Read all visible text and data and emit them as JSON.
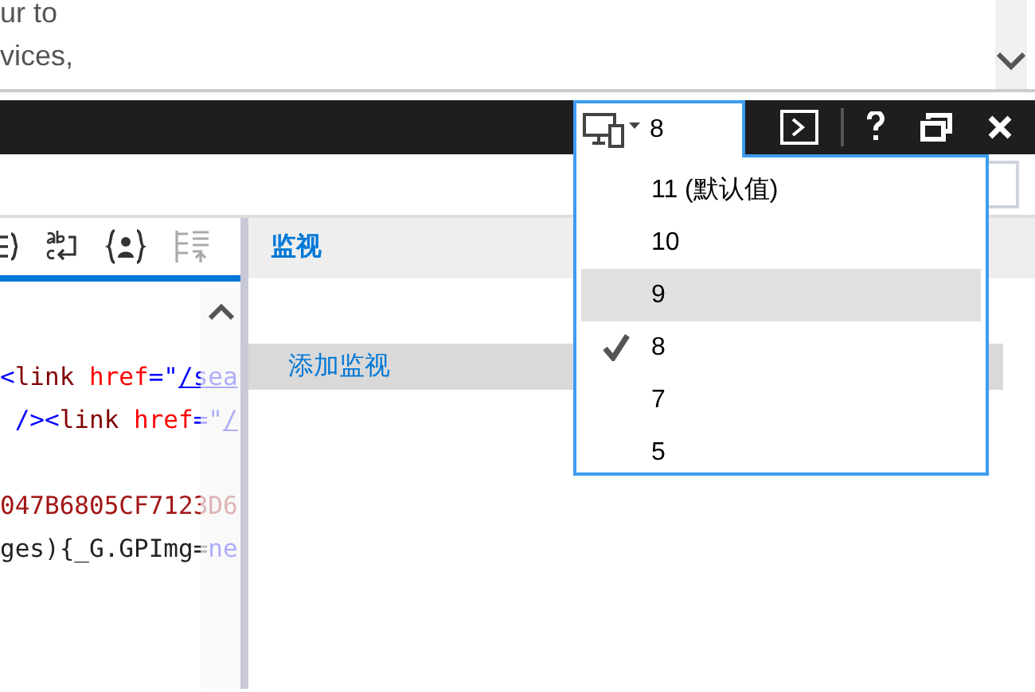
{
  "page_text": [
    "ur to",
    "vices,"
  ],
  "toolbar": {
    "document_mode": "8"
  },
  "document_modes": [
    {
      "label": "11 (默认值)",
      "selected": false,
      "hovered": false
    },
    {
      "label": "10",
      "selected": false,
      "hovered": false
    },
    {
      "label": "9",
      "selected": false,
      "hovered": true
    },
    {
      "label": "8",
      "selected": true,
      "hovered": false
    },
    {
      "label": "7",
      "selected": false,
      "hovered": false
    },
    {
      "label": "5",
      "selected": false,
      "hovered": false
    }
  ],
  "code_lines": [
    {
      "segments": [
        {
          "kind": "punct",
          "text": "<"
        },
        {
          "kind": "tag",
          "text": "link"
        },
        {
          "kind": "attr",
          "text": " href"
        },
        {
          "kind": "punct",
          "text": "=\""
        },
        {
          "kind": "link",
          "text": "/sea"
        }
      ]
    },
    {
      "segments": [
        {
          "kind": "punct",
          "text": " /><"
        },
        {
          "kind": "tag",
          "text": "link"
        },
        {
          "kind": "attr",
          "text": " href"
        },
        {
          "kind": "punct",
          "text": "=\""
        },
        {
          "kind": "link",
          "text": "/"
        }
      ]
    },
    {
      "segments": [
        {
          "kind": "value",
          "text": "047B6805CF7123D6"
        }
      ]
    },
    {
      "segments": [
        {
          "kind": "plain",
          "text": "ges){_G.GPImg="
        },
        {
          "kind": "keyword",
          "text": "ne"
        }
      ]
    }
  ],
  "watch_panel": {
    "title": "监视",
    "add_watch": "添加监视"
  }
}
